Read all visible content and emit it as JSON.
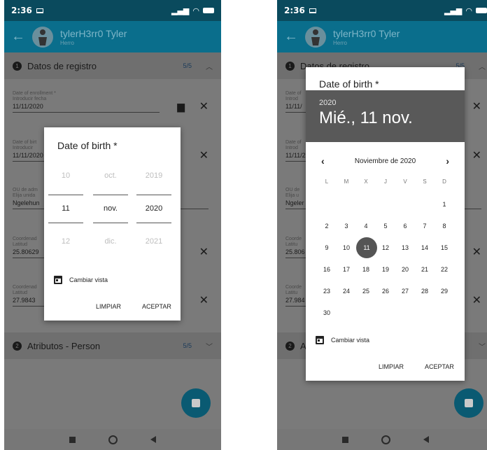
{
  "status": {
    "time": "2:36",
    "icons": "..ıl ≈"
  },
  "appbar": {
    "user_name": "tylerH3rr0 Tyler",
    "user_sub": "Herro"
  },
  "section1": {
    "num": "1",
    "title": "Datos de registro",
    "count": "5/5"
  },
  "section2": {
    "num": "2",
    "title": "Atributos - Person",
    "count": "5/5"
  },
  "fields": [
    {
      "label": "Date of enrollment *",
      "sublabel": "Introducir fecha",
      "value": "11/11/2020"
    },
    {
      "label": "Date of birth *",
      "sublabel": "Introducir fecha",
      "value": "11/11/2020"
    },
    {
      "label": "OU de admin *",
      "sublabel": "Elija unidad",
      "value": "Ngelehun"
    },
    {
      "label": "Coordenadas",
      "sublabel": "Latitud",
      "value": "25.80629"
    },
    {
      "label": "Coordenadas",
      "sublabel": "Latitud",
      "value": "27.9843"
    }
  ],
  "left_right_fragments": {
    "enrollment_label": "Date of",
    "enrollment_sub": "Introd",
    "enrollment_val": "11/11/",
    "birth_label": "Date of",
    "birth_sub": "Introd",
    "birth_val": "11/11/2",
    "ou_label": "OU de",
    "ou_sub": "Elija u",
    "ou_val": "Ngeler",
    "c1_label": "Coorde",
    "c1_sub": "Latitu",
    "c1_val": "25.806",
    "c2_label": "Coorde",
    "c2_sub": "Latitu",
    "c2_val": "27.984",
    "sec1_partial": "Datos de registro",
    "sec2_partial": "A"
  },
  "left_dialog_fragments": {
    "birth_label_frag": "Date of birt",
    "birth_sub_frag": "Introducir",
    "birth_val_frag": "11/11/2020",
    "ou_label_frag": "OU de adm",
    "ou_sub_frag": "Elija unida",
    "ou_val_frag": "Ngelehun",
    "c1_label_frag": "Coordenad",
    "c1_sub_frag": "Latitud",
    "c1_val_frag": "25.80629",
    "c2_label_frag": "Coordenad",
    "c2_sub_frag": "Latitud",
    "c2_val_frag": "27.9843"
  },
  "wheel_dialog": {
    "title": "Date of birth *",
    "day": {
      "prev": "10",
      "sel": "11",
      "next": "12"
    },
    "month": {
      "prev": "oct.",
      "sel": "nov.",
      "next": "dic."
    },
    "year": {
      "prev": "2019",
      "sel": "2020",
      "next": "2021"
    },
    "toggle_label": "Cambiar vista",
    "clear_label": "LIMPIAR",
    "accept_label": "ACEPTAR"
  },
  "calendar_dialog": {
    "title": "Date of birth *",
    "year": "2020",
    "date_display": "Mié., 11 nov.",
    "month_label": "Noviembre de 2020",
    "prev_arrow": "‹",
    "next_arrow": "›",
    "weekdays": [
      "L",
      "M",
      "X",
      "J",
      "V",
      "S",
      "D"
    ],
    "days": [
      "",
      "",
      "",
      "",
      "",
      "",
      "1",
      "2",
      "3",
      "4",
      "5",
      "6",
      "7",
      "8",
      "9",
      "10",
      "11",
      "12",
      "13",
      "14",
      "15",
      "16",
      "17",
      "18",
      "19",
      "20",
      "21",
      "22",
      "23",
      "24",
      "25",
      "26",
      "27",
      "28",
      "29",
      "30"
    ],
    "selected_day": "11",
    "toggle_label": "Cambiar vista",
    "clear_label": "LIMPIAR",
    "accept_label": "ACEPTAR"
  },
  "icons": {
    "back": "back-arrow-icon",
    "calendar": "calendar-icon",
    "close": "close-icon",
    "save": "save-icon"
  }
}
